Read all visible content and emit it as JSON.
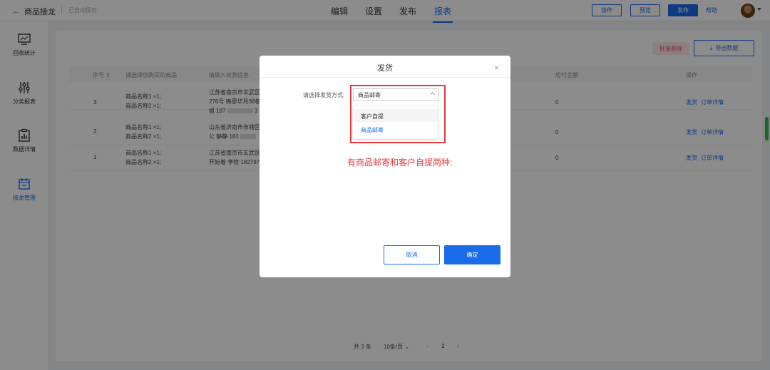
{
  "header": {
    "back_icon": "arrow-left-icon",
    "title": "商品接龙",
    "autosave": "已自动保存",
    "tabs": [
      {
        "label": "编辑"
      },
      {
        "label": "设置"
      },
      {
        "label": "发布"
      },
      {
        "label": "报表",
        "active": true
      }
    ],
    "buttons": {
      "collab": "协作",
      "preview": "预览",
      "publish": "发布"
    },
    "help": "帮助"
  },
  "sidebar": {
    "items": [
      {
        "label": "回收统计",
        "icon": "monitor-chart-icon"
      },
      {
        "label": "分类报表",
        "icon": "sliders-icon"
      },
      {
        "label": "数据详情",
        "icon": "clipboard-chart-icon"
      },
      {
        "label": "接龙管理",
        "icon": "calendar-edit-icon",
        "active": true
      }
    ]
  },
  "toolbar": {
    "batch_delete": "批量删除",
    "export": "导出数据"
  },
  "table": {
    "columns": [
      "序号",
      "请选择您购买的商品",
      "请输入收货信息",
      "应付金额",
      "操作"
    ],
    "rows": [
      {
        "index": "3",
        "goods1": "商品名称1 ×1;",
        "goods2": "商品名称2 ×1;",
        "addr1": "江苏省南京市玄武区",
        "addr2": "276号 晚廖华月38栋",
        "addr3": "姐 187",
        "addr3_tail": "3",
        "amount": "0",
        "action1": "发货",
        "action2": "订单详情"
      },
      {
        "index": "2",
        "goods1": "商品名称1 ×1;",
        "goods2": "商品名称2 ×1;",
        "addr1": "山东省济南市市辖区",
        "addr2": "公 静静 182",
        "addr3": "",
        "addr3_tail": "",
        "amount": "0",
        "action1": "发货",
        "action2": "订单详情"
      },
      {
        "index": "1",
        "goods1": "商品名称1 ×1;",
        "goods2": "商品名称2 ×1;",
        "addr1": "江苏省南京市玄武区",
        "addr2": "开始着 李牧 182797",
        "addr3": "",
        "addr3_tail": "",
        "amount": "0",
        "action1": "发货",
        "action2": "订单详情"
      }
    ]
  },
  "pagination": {
    "total": "共 3 条",
    "page_size": "10条/页",
    "prev": "‹",
    "current": "1",
    "next": "›"
  },
  "dialog": {
    "title": "发货",
    "field_label": "请选择发货方式:",
    "selected": "商品邮寄",
    "options": [
      "客户自提",
      "商品邮寄"
    ],
    "annotation": "有商品邮寄和客户自提两种;",
    "cancel": "取消",
    "confirm": "确定"
  },
  "colors": {
    "accent": "#1a6ce8",
    "annotation_red": "#e43a3a"
  }
}
